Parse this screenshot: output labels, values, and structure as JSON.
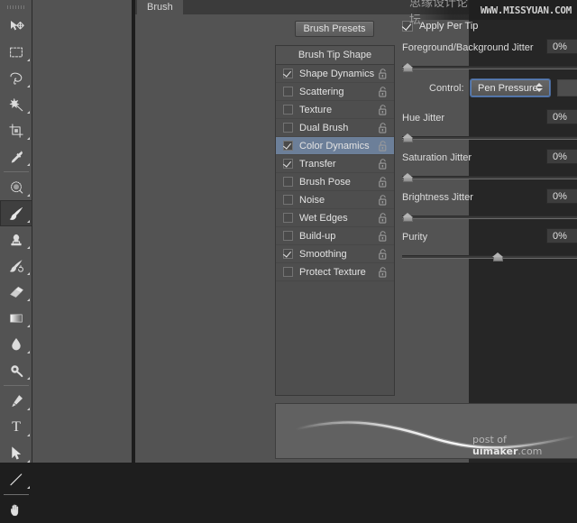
{
  "window": {
    "title": "Brush",
    "background_color": "#1d1d1d"
  },
  "toolbar": {
    "name": "tools-panel",
    "tools": [
      {
        "id": "move",
        "name": "move-tool",
        "glyph": "move",
        "active": false,
        "has_corner": false,
        "separator_after": false
      },
      {
        "id": "marquee",
        "name": "rectangular-marquee-tool",
        "glyph": "marquee",
        "active": false,
        "has_corner": true,
        "separator_after": false
      },
      {
        "id": "lasso",
        "name": "lasso-tool",
        "glyph": "lasso",
        "active": false,
        "has_corner": true,
        "separator_after": false
      },
      {
        "id": "quickselect",
        "name": "quick-selection-tool",
        "glyph": "wand",
        "active": false,
        "has_corner": true,
        "separator_after": false
      },
      {
        "id": "crop",
        "name": "crop-tool",
        "glyph": "crop",
        "active": false,
        "has_corner": true,
        "separator_after": false
      },
      {
        "id": "eyedropper",
        "name": "eyedropper-tool",
        "glyph": "eyedropper",
        "active": false,
        "has_corner": true,
        "separator_after": true
      },
      {
        "id": "healing",
        "name": "spot-healing-brush-tool",
        "glyph": "healing",
        "active": false,
        "has_corner": true,
        "separator_after": false
      },
      {
        "id": "brush",
        "name": "brush-tool",
        "glyph": "brush",
        "active": true,
        "has_corner": true,
        "separator_after": false
      },
      {
        "id": "clone",
        "name": "clone-stamp-tool",
        "glyph": "stamp",
        "active": false,
        "has_corner": true,
        "separator_after": false
      },
      {
        "id": "history",
        "name": "history-brush-tool",
        "glyph": "historybrush",
        "active": false,
        "has_corner": true,
        "separator_after": false
      },
      {
        "id": "eraser",
        "name": "eraser-tool",
        "glyph": "eraser",
        "active": false,
        "has_corner": true,
        "separator_after": false
      },
      {
        "id": "gradient",
        "name": "gradient-tool",
        "glyph": "gradient",
        "active": false,
        "has_corner": true,
        "separator_after": false
      },
      {
        "id": "blur",
        "name": "blur-tool",
        "glyph": "blur",
        "active": false,
        "has_corner": true,
        "separator_after": false
      },
      {
        "id": "dodge",
        "name": "dodge-tool",
        "glyph": "dodge",
        "active": false,
        "has_corner": true,
        "separator_after": true
      },
      {
        "id": "pen",
        "name": "pen-tool",
        "glyph": "pen",
        "active": false,
        "has_corner": true,
        "separator_after": false
      },
      {
        "id": "type",
        "name": "horizontal-type-tool",
        "glyph": "type",
        "active": false,
        "has_corner": true,
        "separator_after": false
      },
      {
        "id": "pathselect",
        "name": "path-selection-tool",
        "glyph": "arrow",
        "active": false,
        "has_corner": true,
        "separator_after": false
      },
      {
        "id": "line",
        "name": "line-shape-tool",
        "glyph": "line",
        "active": false,
        "has_corner": true,
        "separator_after": true
      },
      {
        "id": "hand",
        "name": "hand-tool",
        "glyph": "hand",
        "active": false,
        "has_corner": false,
        "separator_after": false
      }
    ]
  },
  "panel": {
    "tab_label": "Brush",
    "presets_button_label": "Brush Presets",
    "tip_list": {
      "header": "Brush Tip Shape",
      "items": [
        {
          "label": "Shape Dynamics",
          "checked": true,
          "selected": false,
          "locked": false
        },
        {
          "label": "Scattering",
          "checked": false,
          "selected": false,
          "locked": false
        },
        {
          "label": "Texture",
          "checked": false,
          "selected": false,
          "locked": false
        },
        {
          "label": "Dual Brush",
          "checked": false,
          "selected": false,
          "locked": false
        },
        {
          "label": "Color Dynamics",
          "checked": true,
          "selected": true,
          "locked": false
        },
        {
          "label": "Transfer",
          "checked": true,
          "selected": false,
          "locked": false
        },
        {
          "label": "Brush Pose",
          "checked": false,
          "selected": false,
          "locked": false
        },
        {
          "label": "Noise",
          "checked": false,
          "selected": false,
          "locked": false
        },
        {
          "label": "Wet Edges",
          "checked": false,
          "selected": false,
          "locked": false
        },
        {
          "label": "Build-up",
          "checked": false,
          "selected": false,
          "locked": false
        },
        {
          "label": "Smoothing",
          "checked": true,
          "selected": false,
          "locked": false
        },
        {
          "label": "Protect Texture",
          "checked": false,
          "selected": false,
          "locked": false
        }
      ]
    }
  },
  "controls": {
    "apply_per_tip": {
      "label": "Apply Per Tip",
      "checked": true
    },
    "fg_bg_jitter": {
      "label": "Foreground/Background Jitter",
      "value": "0%",
      "slider_percent": 0
    },
    "control": {
      "label": "Control:",
      "value": "Pen Pressure"
    },
    "hue_jitter": {
      "label": "Hue Jitter",
      "value": "0%",
      "slider_percent": 0
    },
    "saturation_jitter": {
      "label": "Saturation Jitter",
      "value": "0%",
      "slider_percent": 0
    },
    "brightness_jitter": {
      "label": "Brightness Jitter",
      "value": "0%",
      "slider_percent": 0
    },
    "purity": {
      "label": "Purity",
      "value": "0%",
      "slider_percent": 50
    }
  },
  "preview": {
    "name": "brush-stroke-preview"
  },
  "watermarks": {
    "top_cn": "思缘设计论坛",
    "top_en": "WWW.MISSYUAN.COM",
    "bottom_prefix": "post of ",
    "bottom_brand": "uimaker",
    "bottom_suffix": ".com"
  },
  "colors": {
    "panel_bg": "#535353",
    "list_bg": "#4e4e4e",
    "selection": "#6c7f99",
    "focus_border": "#5b7fb4",
    "text": "#e3e3e3",
    "canvas_bg": "#1d1d1d",
    "preview_bg": "#616161"
  }
}
